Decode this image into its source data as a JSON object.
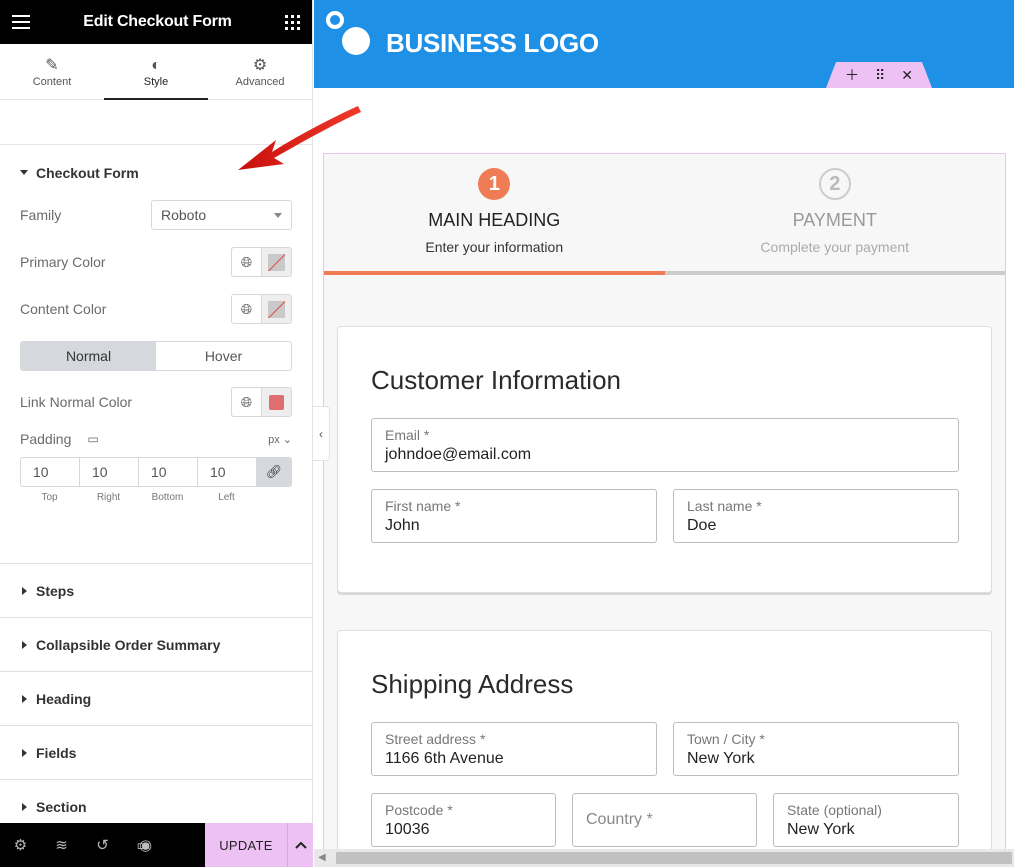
{
  "panel": {
    "title": "Edit Checkout Form",
    "tabs": [
      {
        "label": "Content",
        "icon": "pencil-icon",
        "active": false
      },
      {
        "label": "Style",
        "icon": "contrast-icon",
        "active": true
      },
      {
        "label": "Advanced",
        "icon": "gear-icon",
        "active": false
      }
    ],
    "section_open": {
      "title": "Checkout Form",
      "family_label": "Family",
      "family_value": "Roboto",
      "primary_color_label": "Primary Color",
      "content_color_label": "Content Color",
      "state_normal": "Normal",
      "state_hover": "Hover",
      "link_color_label": "Link Normal Color",
      "link_color_value": "#e06e6e",
      "padding_label": "Padding",
      "padding_unit": "px",
      "padding": {
        "top": "10",
        "right": "10",
        "bottom": "10",
        "left": "10"
      },
      "padding_labels": {
        "top": "Top",
        "right": "Right",
        "bottom": "Bottom",
        "left": "Left"
      }
    },
    "collapsed_sections": [
      "Steps",
      "Collapsible Order Summary",
      "Heading",
      "Fields",
      "Section"
    ],
    "footer": {
      "update_label": "UPDATE"
    }
  },
  "canvas": {
    "logo_text": "BUSINESS LOGO",
    "header_color": "#1e90e6",
    "accent_color": "#f07c56",
    "steps": [
      {
        "number": "1",
        "heading": "MAIN HEADING",
        "sub": "Enter your information",
        "active": true
      },
      {
        "number": "2",
        "heading": "PAYMENT",
        "sub": "Complete your payment",
        "active": false
      }
    ],
    "customer_info": {
      "title": "Customer Information",
      "email_label": "Email *",
      "email_value": "johndoe@email.com",
      "first_label": "First name *",
      "first_value": "John",
      "last_label": "Last name *",
      "last_value": "Doe"
    },
    "shipping": {
      "title": "Shipping Address",
      "street_label": "Street address *",
      "street_value": "1166 6th Avenue",
      "town_label": "Town / City *",
      "town_value": "New York",
      "postcode_label": "Postcode *",
      "postcode_value": "10036",
      "country_placeholder": "Country *",
      "state_label": "State (optional)",
      "state_value": "New York"
    }
  }
}
